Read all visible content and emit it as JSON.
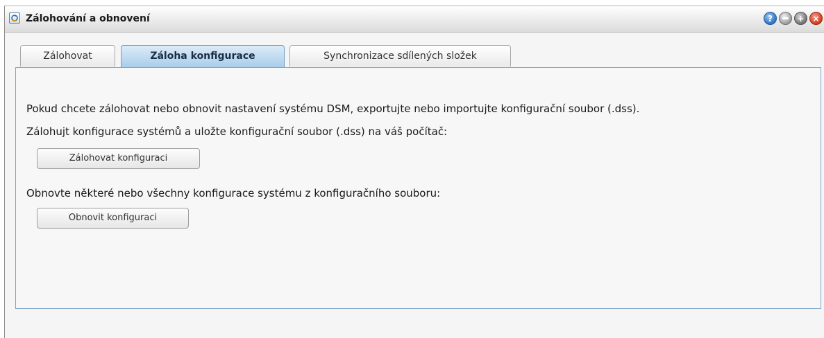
{
  "window": {
    "title": "Zálohování a obnovení",
    "help_glyph": "?",
    "maximize_glyph": "+",
    "close_glyph": "×"
  },
  "tabs": [
    {
      "label": "Zálohovat",
      "active": false
    },
    {
      "label": "Záloha konfigurace",
      "active": true
    },
    {
      "label": "Synchronizace sdílených složek",
      "active": false
    }
  ],
  "content": {
    "intro": "Pokud chcete zálohovat nebo obnovit nastavení systému DSM, exportujte nebo importujte konfigurační soubor (.dss).",
    "backup_text": "Zálohujt konfigurace systémů a uložte konfigurační soubor (.dss) na váš počítač:",
    "backup_button": "Zálohovat konfiguraci",
    "restore_text": "Obnovte některé nebo všechny konfigurace systému z konfiguračního souboru:",
    "restore_button": "Obnovit konfiguraci"
  },
  "colors": {
    "active_tab": "#a9cdea",
    "panel_border": "#7fa6c8",
    "close_button": "#d23b20",
    "help_button": "#2d73c0"
  },
  "icons": {
    "app": "backup-restore-icon",
    "help": "help-icon",
    "minimize": "minimize-icon",
    "maximize": "maximize-icon",
    "close": "close-icon"
  }
}
